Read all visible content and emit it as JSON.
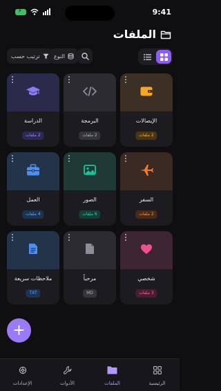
{
  "status_bar": {
    "time": "9:41"
  },
  "header": {
    "title": "الملفات"
  },
  "toolbar": {
    "sort_label": "ترتيب حسب",
    "type_label": "النوع"
  },
  "colors": {
    "accent": "#8b5cf6",
    "fab": "#9b7af5"
  },
  "cards": [
    {
      "name": "الإيصالات",
      "badge": "2 ملفات",
      "icon": "wallet-icon",
      "bg": "#3b3023",
      "icon_color": "#f5a623",
      "badge_bg": "#4a3514",
      "badge_color": "#f5b648"
    },
    {
      "name": "البرمجة",
      "badge": "2 ملفات",
      "icon": "code-icon",
      "bg": "#2b2b31",
      "icon_color": "#8d8d97",
      "badge_bg": "#34343b",
      "badge_color": "#b5b5bf"
    },
    {
      "name": "الدراسة",
      "badge": "2 ملفات",
      "icon": "graduation-cap-icon",
      "bg": "#2b2a4a",
      "icon_color": "#8b7cf6",
      "badge_bg": "#2c2a55",
      "badge_color": "#9f93f7"
    },
    {
      "name": "السفر",
      "badge": "2 ملفات",
      "icon": "airplane-icon",
      "bg": "#3b2a23",
      "icon_color": "#f07c2a",
      "badge_bg": "#4b2b18",
      "badge_color": "#f29451"
    },
    {
      "name": "الصور",
      "badge": "6 ملفات",
      "icon": "image-icon",
      "bg": "#1f3934",
      "icon_color": "#1ec3a0",
      "badge_bg": "#123f36",
      "badge_color": "#3fd3b1"
    },
    {
      "name": "العمل",
      "badge": "4 ملفات",
      "icon": "briefcase-icon",
      "bg": "#22334a",
      "icon_color": "#4f8ff2",
      "badge_bg": "#1c3454",
      "badge_color": "#6ea6f6"
    },
    {
      "name": "شخصي",
      "badge": "3 ملفات",
      "icon": "heart-icon",
      "bg": "#3d2533",
      "icon_color": "#f0508e",
      "badge_bg": "#4b1d33",
      "badge_color": "#f46aa3"
    },
    {
      "name": "مرحباً",
      "badge": "MD",
      "icon": "file-icon",
      "bg": "#2b2b31",
      "icon_color": "#8d8d97",
      "badge_bg": "#34343b",
      "badge_color": "#b5b5bf"
    },
    {
      "name": "ملاحظات سريعة",
      "badge": "TXT",
      "icon": "document-icon",
      "bg": "#22334a",
      "icon_color": "#4f8ff2",
      "badge_bg": "#1c3454",
      "badge_color": "#6ea6f6"
    }
  ],
  "bottom_nav": [
    {
      "label": "الرئيسية",
      "icon": "grid-icon",
      "active": false
    },
    {
      "label": "الملفات",
      "icon": "folder-icon",
      "active": true
    },
    {
      "label": "الأدوات",
      "icon": "wrench-icon",
      "active": false
    },
    {
      "label": "الإعدادات",
      "icon": "gear-icon",
      "active": false
    }
  ]
}
